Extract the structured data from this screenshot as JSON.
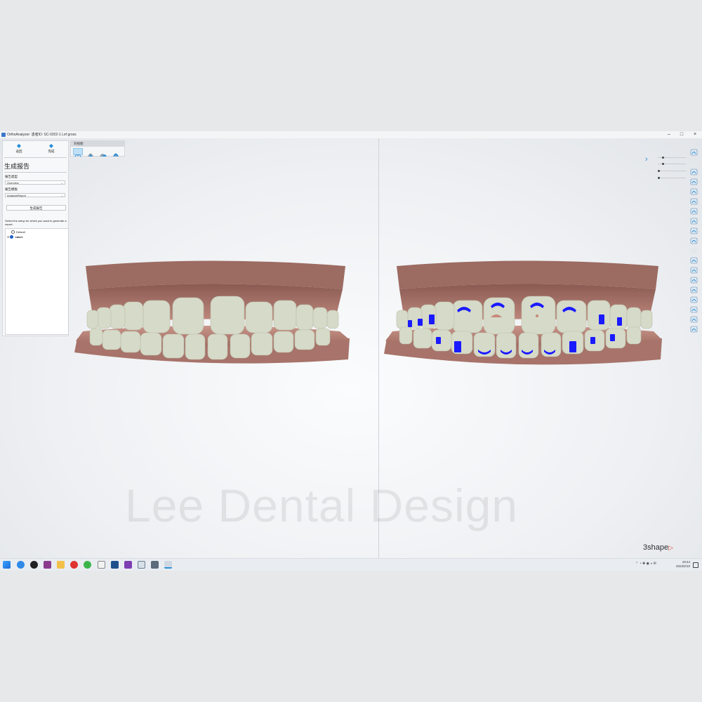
{
  "window": {
    "title": "OrthoAnalyzer: 患者ID: SC-0202-1 Lef gross",
    "minimize": "–",
    "maximize": "□",
    "close": "×"
  },
  "left_panel": {
    "back_label": "返回",
    "finish_label": "完成",
    "title": "生成报告",
    "report_type_label": "报告类型",
    "report_type_value": "Overview",
    "report_template_label": "报告模板",
    "report_template_value": "AnalysisReport",
    "generate_button": "生成报告",
    "instruction": "Select the setup for which you want to generate a report:",
    "setups": [
      {
        "label": "Default",
        "selected": false
      },
      {
        "label": "case1",
        "selected": true
      }
    ]
  },
  "view_strip": {
    "header": "对视图",
    "buttons": [
      "view-both-icon",
      "view-upper-icon",
      "view-lower-icon",
      "view-side-icon"
    ]
  },
  "right_toolbar": {
    "icons": [
      "tooth-view-icon",
      "blank-icon",
      "tooth-box-1-icon",
      "tooth-box-2-icon",
      "tooth-box-3-icon",
      "tooth-box-4-icon",
      "tooth-box-5-icon",
      "tooth-box-6-icon",
      "tooth-box-7-icon",
      "pen-icon",
      "blank-icon",
      "ruler-icon",
      "tooth-outline-icon",
      "tooth-occlusion-icon",
      "magnifier-icon",
      "camera-icon",
      "rotate-icon",
      "fit-view-icon",
      "settings-icon"
    ]
  },
  "watermark": "Lee Dental Design",
  "brand": "3shape",
  "taskbar": {
    "apps": [
      "windows-start-icon",
      "browser-icon",
      "obs-icon",
      "winrar-icon",
      "folder-icon",
      "weibo-icon",
      "wechat-icon",
      "qq-icon",
      "remote-icon",
      "edge-icon",
      "exocad-icon",
      "3shape-icon",
      "notes-icon"
    ],
    "time": "19:44",
    "date": "2023/2/10"
  },
  "colors": {
    "accent": "#2a8fd8",
    "gum": "#b57a6f",
    "tooth": "#d8dccb",
    "attachment": "#1a1aff"
  }
}
